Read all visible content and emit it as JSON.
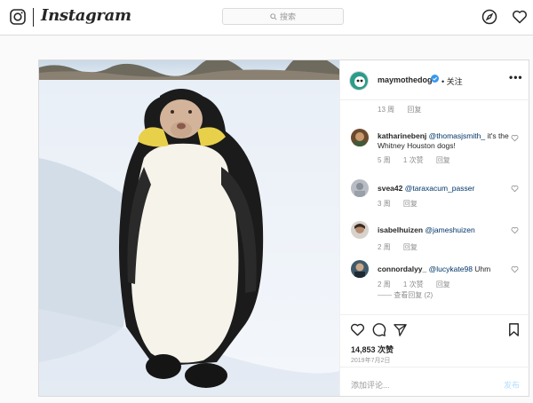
{
  "nav": {
    "logo_text": "Instagram",
    "search_placeholder": "搜索"
  },
  "post": {
    "author": "maymothedog",
    "follow": "• 关注",
    "first_meta": {
      "age": "13 周",
      "reply": "回复"
    },
    "comments": [
      {
        "user": "katharinebenj",
        "mention": "@thomasjsmith_",
        "text": " it's the Whitney Houston dogs!",
        "age": "5 周",
        "likes": "1 次赞",
        "reply": "回复"
      },
      {
        "user": "svea42",
        "mention": "@taraxacum_passer",
        "text": "",
        "age": "3 周",
        "likes": "",
        "reply": "回复"
      },
      {
        "user": "isabelhuizen",
        "mention": "@jameshuizen",
        "text": "",
        "age": "2 周",
        "likes": "",
        "reply": "回复"
      },
      {
        "user": "connordalyy_",
        "mention": "@lucykate98",
        "text": " Uhm",
        "age": "2 周",
        "likes": "1 次赞",
        "reply": "回复"
      }
    ],
    "view_replies": "—— 查看回复 (2)",
    "likes_count": "14,853 次赞",
    "date": "2019年7月2日",
    "add_comment_placeholder": "添加评论...",
    "post_button": "发布"
  },
  "colors": {
    "link": "#003569",
    "verified": "#3897f0",
    "muted": "#8e8e8e"
  }
}
